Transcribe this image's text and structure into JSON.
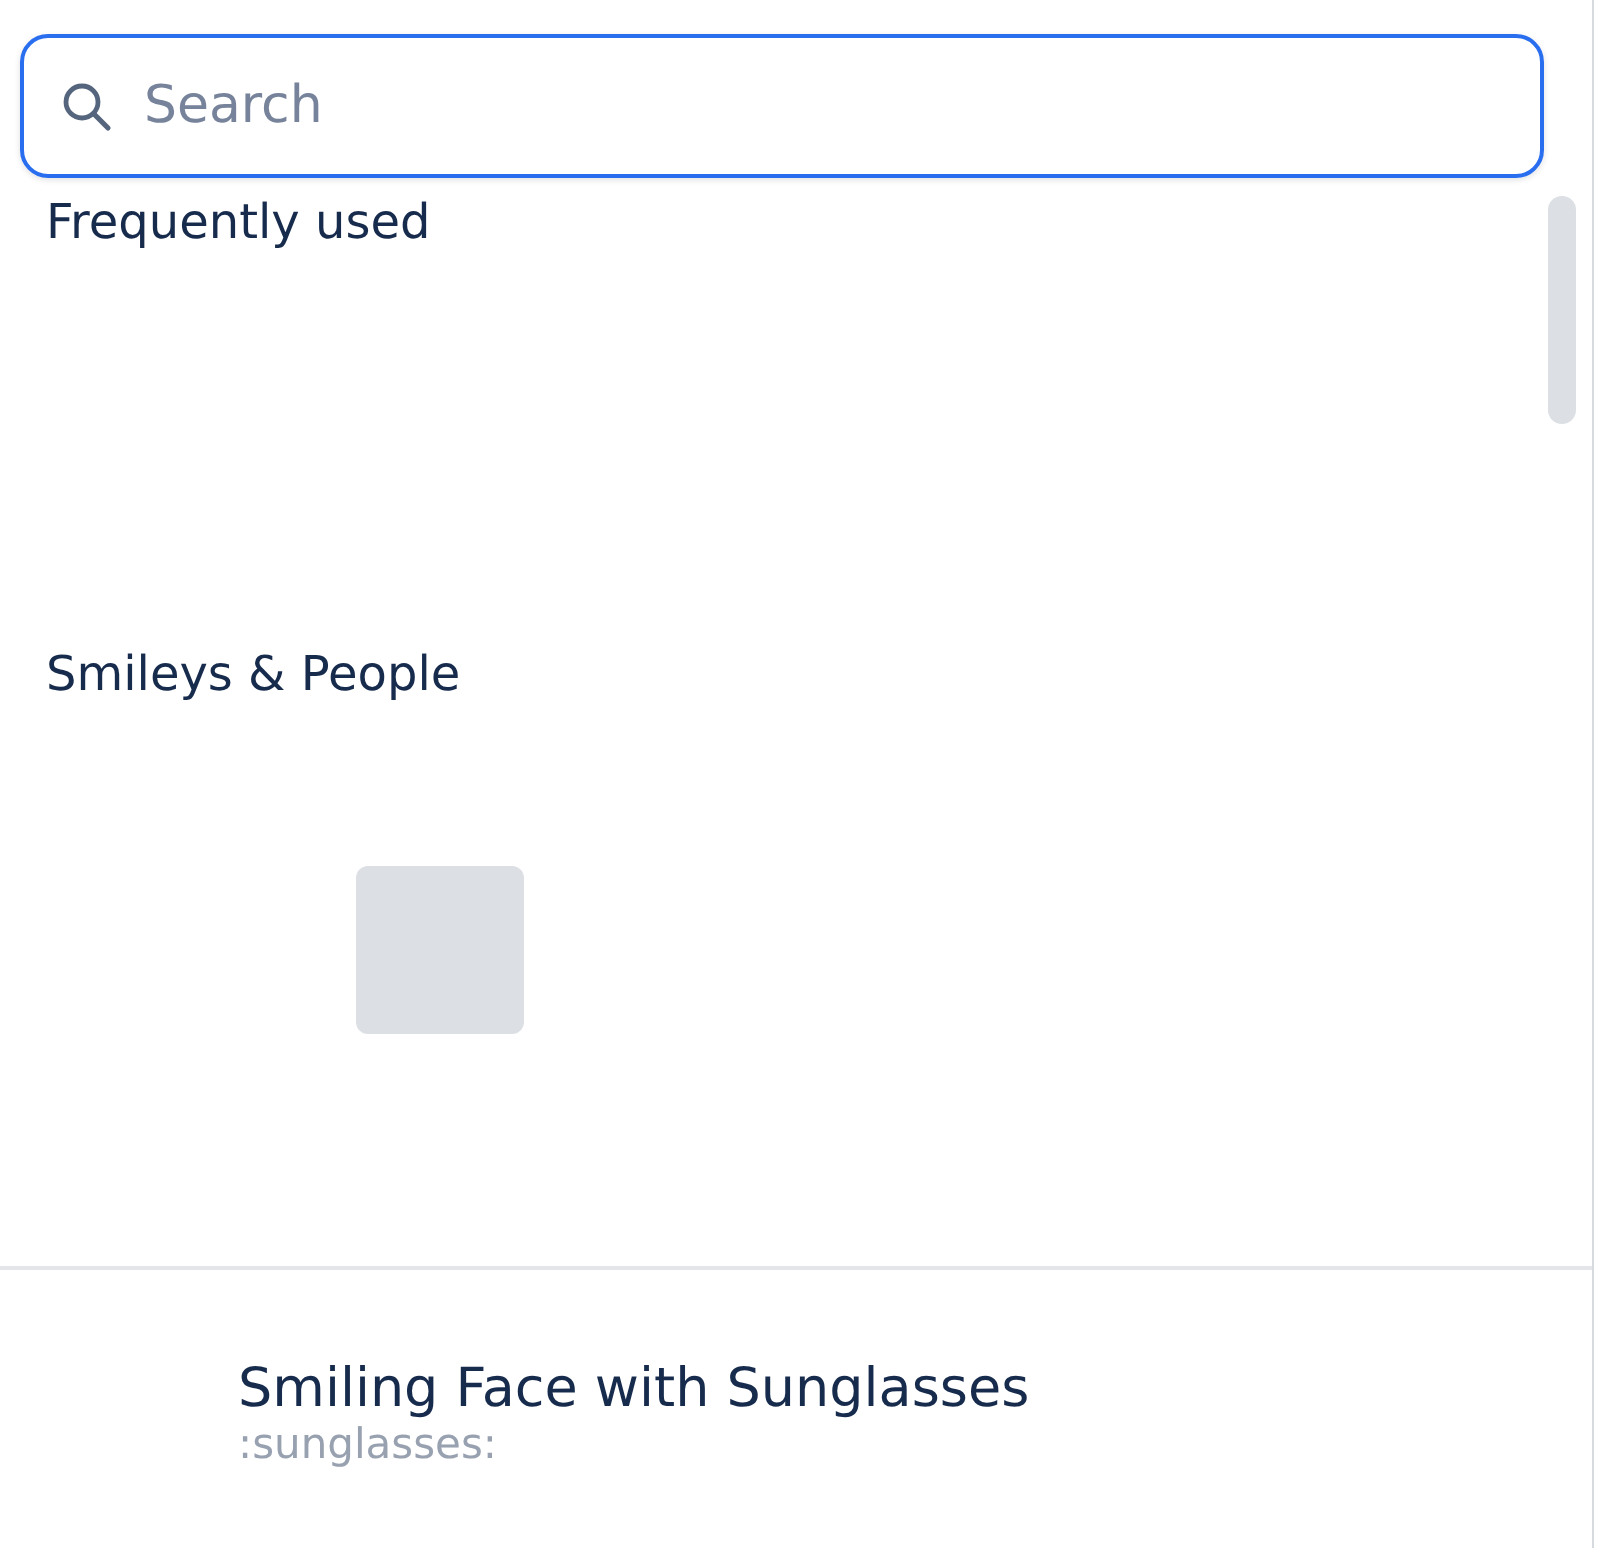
{
  "search": {
    "placeholder": "Search"
  },
  "sections": [
    {
      "title": "Frequently used"
    },
    {
      "title": "Smileys & People"
    }
  ],
  "preview": {
    "name": "Smiling Face with Sunglasses",
    "shortcode": ":sunglasses:"
  }
}
